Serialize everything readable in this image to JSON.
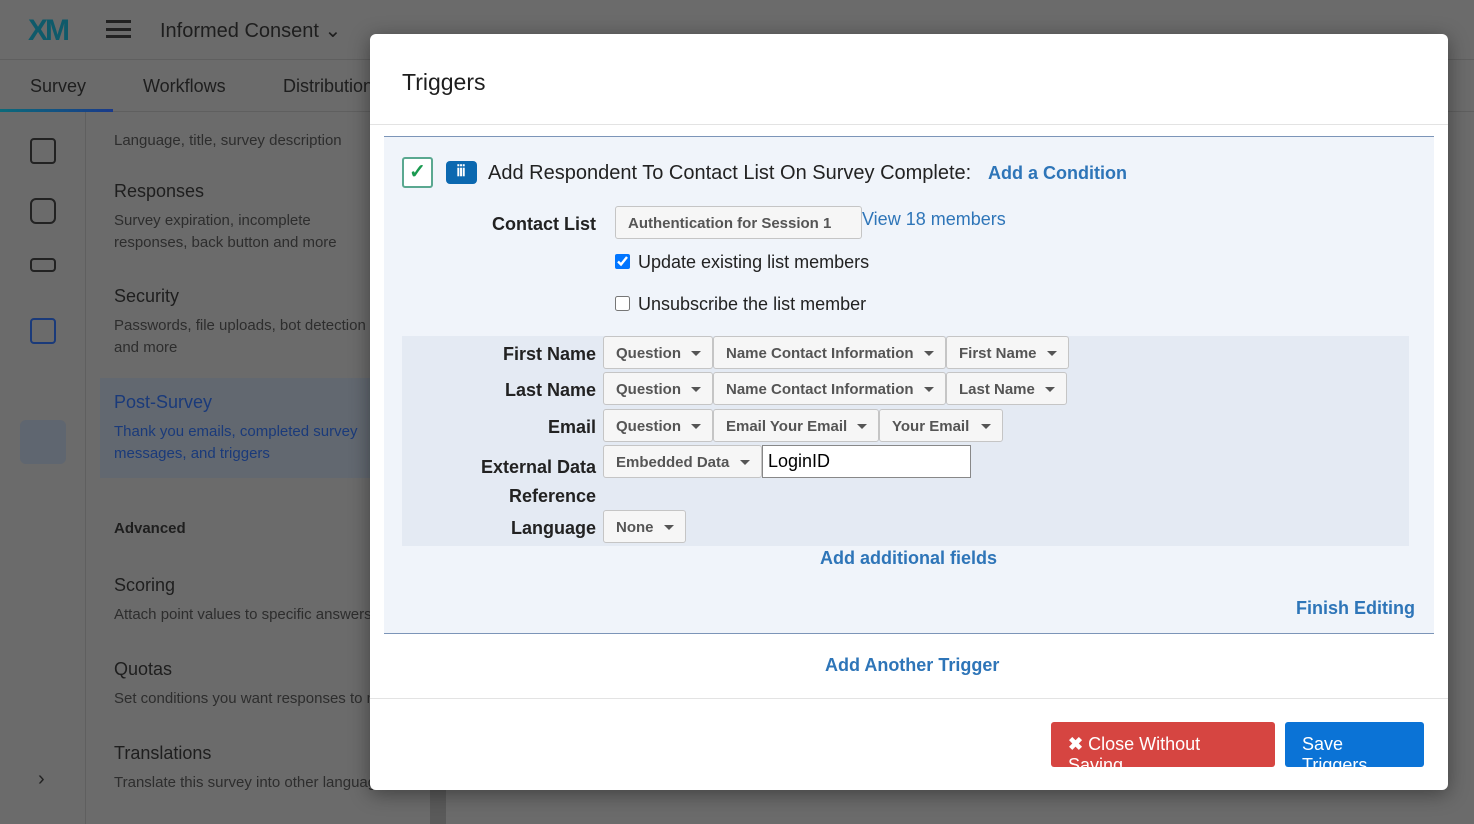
{
  "header": {
    "logo": "XM",
    "project_title": "Informed Consent"
  },
  "tabs": [
    "Survey",
    "Workflows",
    "Distributions"
  ],
  "settings": [
    {
      "title": "",
      "desc": "Language, title, survey description"
    },
    {
      "title": "Responses",
      "desc": "Survey expiration, incomplete responses, back button and more"
    },
    {
      "title": "Security",
      "desc": "Passwords, file uploads, bot detection and more"
    },
    {
      "title": "Post-Survey",
      "desc": "Thank you emails, completed survey messages, and triggers"
    },
    {
      "title": "Advanced",
      "desc": ""
    },
    {
      "title": "Scoring",
      "desc": "Attach point values to specific answers"
    },
    {
      "title": "Quotas",
      "desc": "Set conditions you want responses to meet"
    },
    {
      "title": "Translations",
      "desc": "Translate this survey into other languages"
    }
  ],
  "modal": {
    "title": "Triggers",
    "trigger_label": "Add Respondent To Contact List On Survey Complete:",
    "add_condition": "Add a Condition",
    "contact_list_label": "Contact List",
    "contact_list_value": "Authentication for Session 1",
    "view_members": "View 18 members",
    "update_existing": {
      "label": "Update existing list members",
      "checked": true
    },
    "unsubscribe": {
      "label": "Unsubscribe the list member",
      "checked": false
    },
    "fields": [
      {
        "label": "First Name",
        "source": "Question",
        "question": "Name Contact Information",
        "field": "First Name"
      },
      {
        "label": "Last Name",
        "source": "Question",
        "question": "Name Contact Information",
        "field": "Last Name"
      },
      {
        "label": "Email",
        "source": "Question",
        "question": "Email Your Email",
        "field": "Your Email"
      },
      {
        "label": "External Data Reference",
        "source": "Embedded Data",
        "value": "LoginID"
      },
      {
        "label": "Language",
        "source": "None"
      }
    ],
    "add_fields": "Add additional fields",
    "finish_editing": "Finish Editing",
    "add_trigger": "Add Another Trigger",
    "close_label": "Close Without Saving",
    "save_label": "Save Triggers"
  },
  "colors": {
    "accent": "#2e75b8",
    "danger": "#d64541",
    "primary": "#0b73d6"
  }
}
